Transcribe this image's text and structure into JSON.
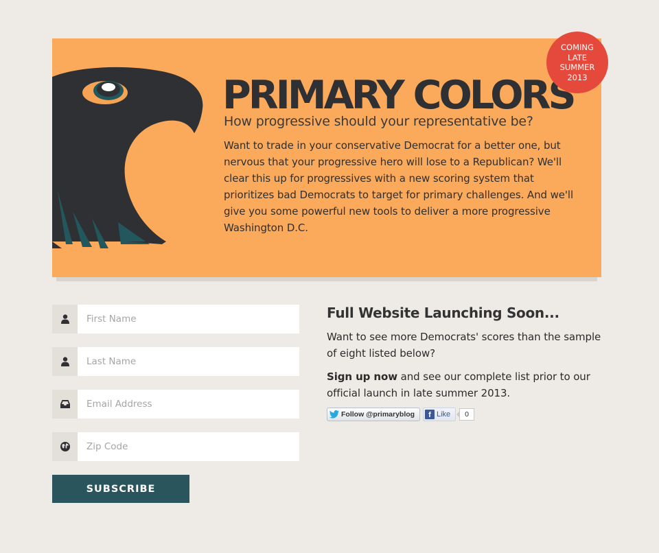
{
  "hero": {
    "title": "PRIMARY COLORS",
    "subtitle": "How progressive should your representative be?",
    "body": "Want to trade in your conservative Democrat for a better one, but nervous that your progressive hero will lose to a Republican? We'll clear this up for progressives with a new scoring system that prioritizes bad Democrats to target for primary challenges. And we'll give you some powerful new tools to deliver a more progressive Washington D.C.",
    "colors": {
      "background": "#fbaa5b",
      "eagle": "#2f3033",
      "eagle_accent": "#21575d"
    }
  },
  "badge": {
    "lines": [
      "COMING",
      "LATE",
      "SUMMER",
      "2013"
    ],
    "color": "#e5493c"
  },
  "form": {
    "fields": [
      {
        "icon": "user-icon",
        "placeholder": "First Name",
        "value": ""
      },
      {
        "icon": "user-icon",
        "placeholder": "Last Name",
        "value": ""
      },
      {
        "icon": "inbox-icon",
        "placeholder": "Email Address",
        "value": ""
      },
      {
        "icon": "globe-icon",
        "placeholder": "Zip Code",
        "value": ""
      }
    ],
    "submit_label": "SUBSCRIBE",
    "submit_color": "#2a555c"
  },
  "sidebar": {
    "heading": "Full Website Launching Soon...",
    "paragraph1": "Want to see more Democrats' scores than the sample of eight listed below?",
    "paragraph2_strong": "Sign up now",
    "paragraph2_rest": " and see our complete list prior to our official launch in late summer 2013.",
    "twitter_label": "Follow @primaryblog",
    "facebook_label": "Like",
    "facebook_logo": "f",
    "facebook_count": "0"
  }
}
